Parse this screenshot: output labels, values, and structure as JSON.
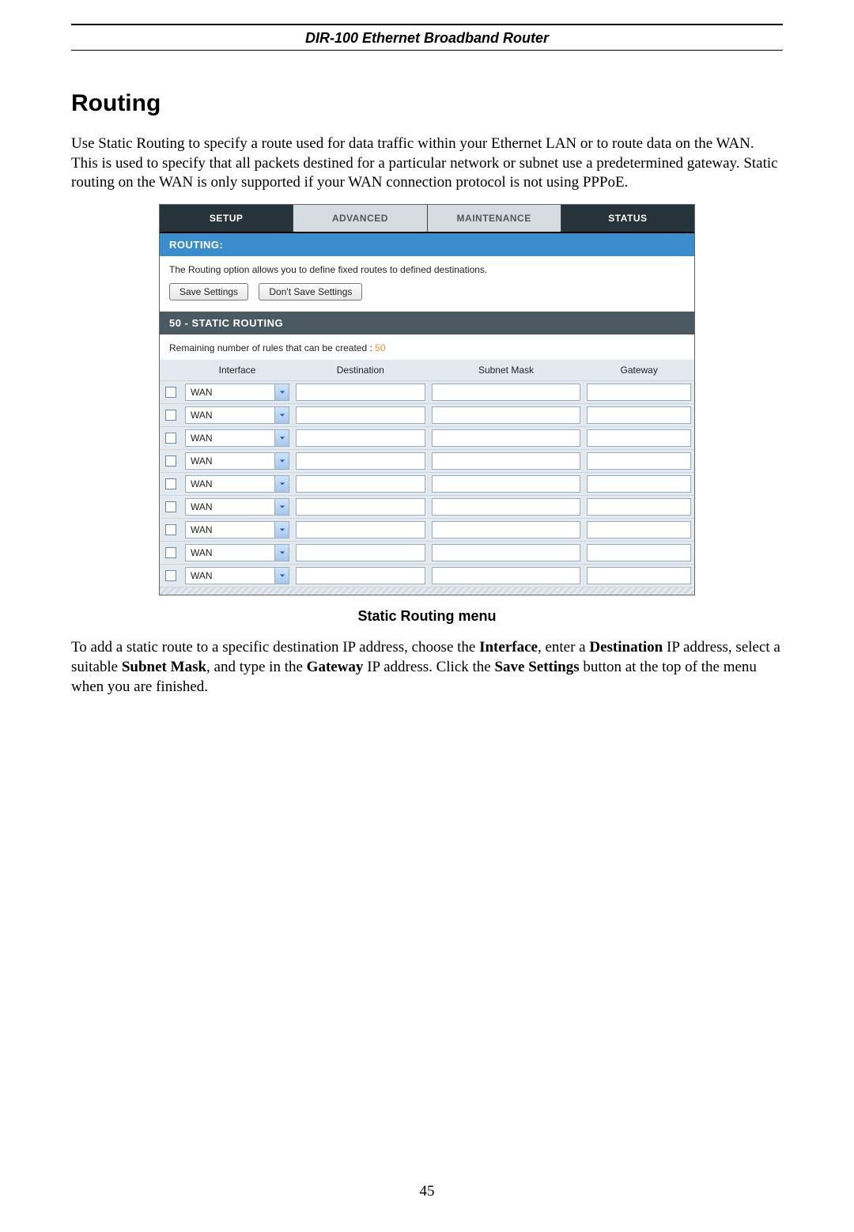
{
  "header": {
    "product": "DIR-100 Ethernet Broadband Router"
  },
  "title": "Routing",
  "intro": "Use Static Routing to specify a route used for data traffic within your Ethernet LAN or to route data on the WAN. This is used to specify that all packets destined for a particular network or subnet use a predetermined gateway. Static routing on the WAN is only supported if your WAN connection protocol is not using PPPoE.",
  "tabs": {
    "setup": "SETUP",
    "advanced": "ADVANCED",
    "maintenance": "MAINTENANCE",
    "status": "STATUS"
  },
  "routing_panel": {
    "heading": "ROUTING:",
    "desc": "The Routing option allows you to define fixed routes to defined destinations.",
    "save": "Save Settings",
    "dont_save": "Don't Save Settings"
  },
  "static_panel": {
    "heading": "50 - STATIC ROUTING",
    "remaining_prefix": "Remaining number of rules that can be created : ",
    "remaining_count": "50"
  },
  "cols": {
    "interface": "Interface",
    "destination": "Destination",
    "subnet": "Subnet Mask",
    "gateway": "Gateway"
  },
  "rows": [
    {
      "iface": "WAN"
    },
    {
      "iface": "WAN"
    },
    {
      "iface": "WAN"
    },
    {
      "iface": "WAN"
    },
    {
      "iface": "WAN"
    },
    {
      "iface": "WAN"
    },
    {
      "iface": "WAN"
    },
    {
      "iface": "WAN"
    },
    {
      "iface": "WAN"
    }
  ],
  "caption": "Static Routing menu",
  "outro_parts": {
    "p1": "To add a static route to a specific destination IP address, choose the ",
    "b1": "Interface",
    "p2": ", enter a ",
    "b2": "Destination",
    "p3": " IP address, select a suitable ",
    "b3": "Subnet Mask",
    "p4": ", and type in the ",
    "b4": "Gateway",
    "p5": " IP address. Click the ",
    "b5": "Save Settings",
    "p6": " button at the top of the menu when you are finished."
  },
  "page": "45"
}
